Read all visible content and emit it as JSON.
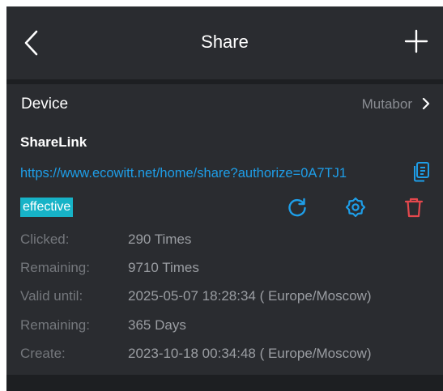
{
  "header": {
    "title": "Share"
  },
  "device": {
    "label": "Device",
    "value": "Mutabor"
  },
  "share_link": {
    "title": "ShareLink",
    "url": "https://www.ecowitt.net/home/share?authorize=0A7TJ1",
    "status": "effective",
    "rows": [
      {
        "label": "Clicked:",
        "value": "290 Times"
      },
      {
        "label": "Remaining:",
        "value": "9710 Times"
      },
      {
        "label": "Valid until:",
        "value": "2025-05-07 18:28:34 ( Europe/Moscow)"
      },
      {
        "label": "Remaining:",
        "value": "365 Days"
      },
      {
        "label": "Create:",
        "value": "2023-10-18 00:34:48 ( Europe/Moscow)"
      }
    ]
  },
  "colors": {
    "accent_blue": "#1e9ee8",
    "badge_teal": "#17b3c7",
    "delete_red": "#e5484d",
    "background": "#1d1f22",
    "panel": "#2a2c30"
  },
  "icons": {
    "back": "chevron-left-icon",
    "add": "plus-icon",
    "device_chevron": "chevron-right-icon",
    "copy": "copy-icon",
    "refresh": "refresh-icon",
    "settings": "gear-icon",
    "delete": "trash-icon"
  }
}
